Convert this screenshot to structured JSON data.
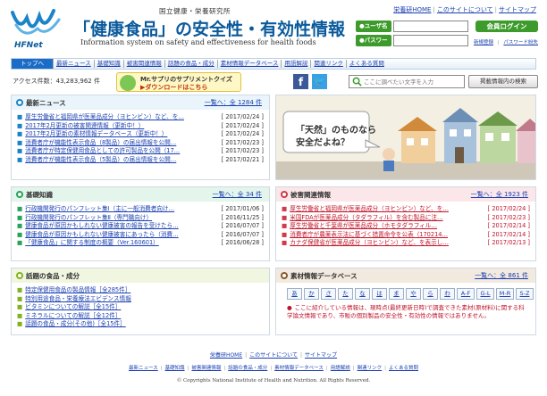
{
  "header": {
    "org_name": "国立健康・栄養研究所",
    "title_main": "「健康食品」の安全性・有効性情報",
    "subtitle": "Information system on safety and effectiveness for health foods",
    "logo_text": "HFNet",
    "top_links": [
      "栄養研HOME",
      "このサイトについて",
      "サイトマップ"
    ]
  },
  "login": {
    "user_label": "●ユーザ名",
    "password_label": "●パスワード",
    "member_login_label": "会員ログイン",
    "new_registration": "新規登録",
    "forgot_password": "パスワード紛失"
  },
  "nav": {
    "items": [
      "トップへ",
      "最新ニュース",
      "基礎知識",
      "被害関連情報",
      "話題の食品・成分",
      "素材情報データベース",
      "用語解説",
      "関連リンク",
      "よくある質問"
    ]
  },
  "info_bar": {
    "access_count": "アクセス件数：43,283,962 件",
    "quiz_line1": "Mr.サプリのサプリメントクイズ",
    "quiz_line2": "▶ダウンロードはこちら",
    "facebook_glyph": "f",
    "twitter_glyph": "🐦",
    "search_placeholder": "ここに調べたい文字を入力",
    "search_button": "掲載情報内の検索"
  },
  "hero": {
    "line1": "「天然」のものなら",
    "line2": "安全だよね？"
  },
  "news": {
    "title": "最新ニュース",
    "more": "一覧へ：全 1284 件",
    "items": [
      {
        "text": "厚生労働省と福岡県が医薬品成分（ヨヒンビン）など、を…",
        "date": "[ 2017/02/24 ]"
      },
      {
        "text": "2017年2月更新の被害関連情報（更新中！）",
        "date": "[ 2017/02/24 ]"
      },
      {
        "text": "2017年2月更新の素材情報データベース（更新中！）",
        "date": "[ 2017/02/24 ]"
      },
      {
        "text": "消費者庁が機能性表示食品（8製品）の届出情報を公開…",
        "date": "[ 2017/02/23 ]"
      },
      {
        "text": "消費者庁が特定保健用食品としての許可製品を公開（17…",
        "date": "[ 2017/02/23 ]"
      },
      {
        "text": "消費者庁が機能性表示食品（5製品）の届出情報を公開…",
        "date": "[ 2017/02/21 ]"
      }
    ]
  },
  "basic": {
    "title": "基礎知識",
    "more": "一覧へ：全 34 件",
    "items": [
      {
        "text": "行政機関発行のパンフレット集Ⅰ（主に一般消費者向け…",
        "date": "[ 2017/01/06 ]"
      },
      {
        "text": "行政機関発行のパンフレット集Ⅱ（専門職向け）",
        "date": "[ 2016/11/25 ]"
      },
      {
        "text": "健康食品が原因かもしれない健康被害の報告を受けたら…",
        "date": "[ 2016/07/07 ]"
      },
      {
        "text": "健康食品が原因かもしれない健康被害にあったら（消費…",
        "date": "[ 2016/07/07 ]"
      },
      {
        "text": "「健康食品」に関する制度の概要（Ver.160601）",
        "date": "[ 2016/06/28 ]"
      }
    ]
  },
  "damage": {
    "title": "被害関連情報",
    "more": "一覧へ：全 1923 件",
    "items": [
      {
        "text": "厚生労働省と福岡県が医薬品成分（ヨヒンビン）など、を…",
        "date": "[ 2017/02/24 ]"
      },
      {
        "text": "米国FDAが医薬品成分（タダラフィル）を含む製品に注…",
        "date": "[ 2017/02/23 ]"
      },
      {
        "text": "厚生労働省と千葉県が医薬品成分（ホモタダラフィル…",
        "date": "[ 2017/02/14 ]"
      },
      {
        "text": "消費者庁が農薬表示法に基づく措置命令を公表（170214…",
        "date": "[ 2017/02/14 ]"
      },
      {
        "text": "カナダ保健省が医薬品成分（ヨヒンビン）など、を表示し…",
        "date": "[ 2017/02/13 ]"
      }
    ]
  },
  "topics": {
    "title": "話題の食品・成分",
    "items": [
      {
        "text": "特定保健用食品の製品情報［全285件］"
      },
      {
        "text": "特別用途食品・栄養療法エビデンス情報"
      },
      {
        "text": "ビタミンについての解説［全15件］"
      },
      {
        "text": "ミネラルについての解説［全12件］"
      },
      {
        "text": "話題の食品・成分(その他)［全15件］"
      }
    ]
  },
  "materials": {
    "title": "素材情報データベース",
    "more": "一覧へ：全 861 件",
    "kana": [
      "あ",
      "か",
      "さ",
      "た",
      "な",
      "は",
      "ま",
      "や",
      "ら",
      "わ",
      "A-F",
      "G-L",
      "M-R",
      "S-Z"
    ],
    "note": "ここに紹介している情報は、現時点(最終更新日時)で調査できた素材(原材料)に関する科学論文情報であり、市販の個別製品の安全性・有効性の情報ではありません。"
  },
  "footer": {
    "links1": [
      "栄養研HOME",
      "このサイトについて",
      "サイトマップ"
    ],
    "links2": [
      "最新ニュース",
      "基礎知識",
      "被害関連情報",
      "話題の食品・成分",
      "素材情報データベース",
      "用語解説",
      "関連リンク",
      "よくある質問"
    ],
    "copyright": "© Copyrights National Institute of Health and Nutrition. All Rights Reserved."
  },
  "colors": {
    "brand_blue": "#0a5a9c",
    "login_green": "#3c9b2a",
    "nav_active": "#1b6cc6",
    "alert_red": "#c0142a"
  }
}
